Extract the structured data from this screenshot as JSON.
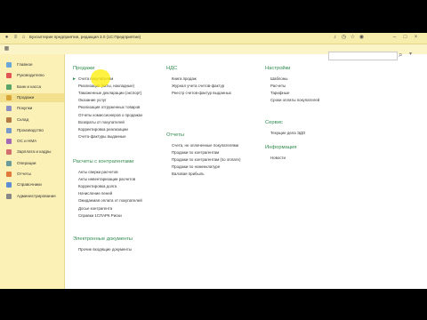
{
  "window": {
    "title": "Бухгалтерия предприятия, редакция 3.0 (1С:Предприятие)"
  },
  "toolbar": {
    "search_placeholder": ""
  },
  "sidebar": {
    "items": [
      {
        "label": "Главное",
        "icon": "home-icon",
        "color": "#6aa7d8"
      },
      {
        "label": "Руководителю",
        "icon": "chart-icon",
        "color": "#e25656"
      },
      {
        "label": "Банк и касса",
        "icon": "bank-icon",
        "color": "#5aa469"
      },
      {
        "label": "Продажи",
        "icon": "sales-icon",
        "color": "#d9a63a",
        "active": true
      },
      {
        "label": "Покупки",
        "icon": "purchases-icon",
        "color": "#8a8fc4"
      },
      {
        "label": "Склад",
        "icon": "warehouse-icon",
        "color": "#b77b45"
      },
      {
        "label": "Производство",
        "icon": "production-icon",
        "color": "#7b9acc"
      },
      {
        "label": "ОС и НМА",
        "icon": "assets-icon",
        "color": "#a56ab8"
      },
      {
        "label": "Зарплата и кадры",
        "icon": "salary-icon",
        "color": "#d46f6f"
      },
      {
        "label": "Операции",
        "icon": "operations-icon",
        "color": "#6b9c9c"
      },
      {
        "label": "Отчеты",
        "icon": "reports-icon",
        "color": "#e07a3a"
      },
      {
        "label": "Справочники",
        "icon": "directories-icon",
        "color": "#5f8dd3"
      },
      {
        "label": "Администрирование",
        "icon": "admin-icon",
        "color": "#888888"
      }
    ]
  },
  "sales": {
    "title": "Продажи",
    "items": [
      "Счета покупателям",
      "Реализация (акты, накладные)",
      "Таможенные декларации (экспорт)",
      "Оказание услуг",
      "Реализация отгруженных товаров",
      "Отчеты комиссионеров о продажах",
      "Возвраты от покупателей",
      "Корректировка реализации",
      "Счета-фактуры выданные"
    ]
  },
  "settlements": {
    "title": "Расчеты с контрагентами",
    "items": [
      "Акты сверки расчетов",
      "Акты инвентаризации расчетов",
      "Корректировка долга",
      "Начисление пеней",
      "Ожидаемая оплата от покупателей",
      "Досье контрагента",
      "Справки 1СПАРК Риски"
    ]
  },
  "edocs": {
    "title": "Электронные документы",
    "items": [
      "Прочие входящие документы"
    ]
  },
  "vat": {
    "title": "НДС",
    "items": [
      "Книга продаж",
      "Журнал учета счетов-фактур",
      "Реестр счетов-фактур выданных"
    ]
  },
  "reports": {
    "title": "Отчеты",
    "items": [
      "Счета, не оплаченные покупателями",
      "Продажи по контрагентам",
      "Продажи по контрагентам (по оплате)",
      "Продажи по номенклатуре",
      "Валовая прибыль"
    ]
  },
  "settings": {
    "title": "Настройки",
    "items": [
      "Шаблоны",
      "Расчеты",
      "Тарифные",
      "Сроки оплаты покупателей"
    ]
  },
  "service": {
    "title": "Сервис",
    "items": [
      "Текущие дела ЭДО"
    ]
  },
  "info": {
    "title": "Информация",
    "items": [
      "Новости"
    ]
  }
}
